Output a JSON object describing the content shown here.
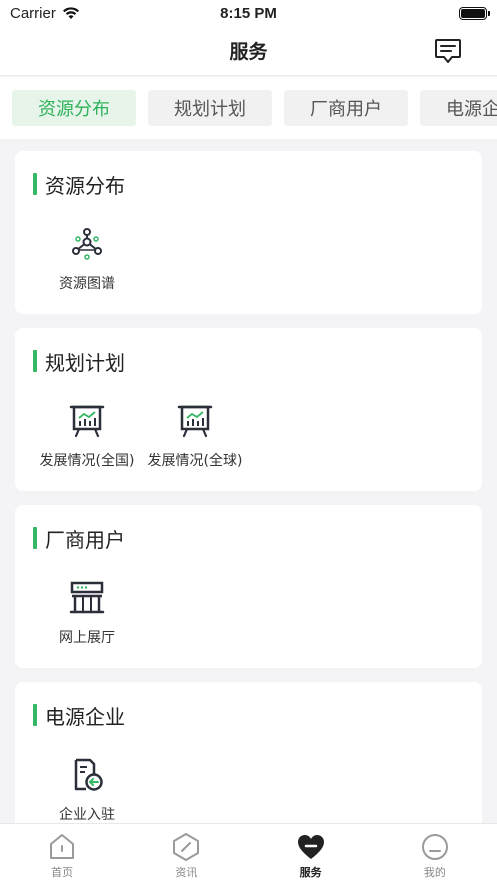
{
  "status_bar": {
    "carrier": "Carrier",
    "time": "8:15 PM"
  },
  "nav": {
    "title": "服务"
  },
  "tabs": [
    {
      "label": "资源分布",
      "active": true
    },
    {
      "label": "规划计划",
      "active": false
    },
    {
      "label": "厂商用户",
      "active": false
    },
    {
      "label": "电源企业",
      "active": false
    }
  ],
  "sections": [
    {
      "title": "资源分布",
      "items": [
        {
          "label": "资源图谱",
          "icon": "network-graph-icon"
        }
      ]
    },
    {
      "title": "规划计划",
      "items": [
        {
          "label": "发展情况(全国)",
          "icon": "chart-board-icon"
        },
        {
          "label": "发展情况(全球)",
          "icon": "chart-board-icon"
        }
      ]
    },
    {
      "title": "厂商用户",
      "items": [
        {
          "label": "网上展厅",
          "icon": "storefront-icon"
        }
      ]
    },
    {
      "title": "电源企业",
      "items": [
        {
          "label": "企业入驻",
          "icon": "document-enter-icon"
        }
      ]
    }
  ],
  "tab_bar": [
    {
      "label": "首页",
      "icon": "home-icon",
      "active": false
    },
    {
      "label": "资讯",
      "icon": "compass-icon",
      "active": false
    },
    {
      "label": "服务",
      "icon": "heart-icon",
      "active": true
    },
    {
      "label": "我的",
      "icon": "profile-icon",
      "active": false
    }
  ],
  "colors": {
    "accent": "#35b864",
    "tab_active_bg": "#e6f4ea",
    "icon_dark": "#2a2f3a"
  }
}
